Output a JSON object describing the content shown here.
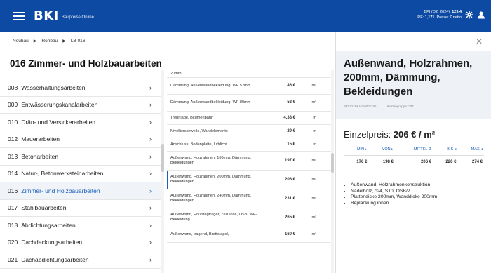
{
  "app": {
    "logo": "BKI",
    "subtitle": "Baupreise Online",
    "index_line1_label": "BPI (Q2, 2024):",
    "index_line1_value": "129,4",
    "index_line2_label": "RF:",
    "index_line2_value": "1,171",
    "index_line2_suffix": "Preise: € netto"
  },
  "breadcrumb": [
    "Neubau",
    "Rohbau",
    "LB 016"
  ],
  "page_title": "016  Zimmer- und Holzbauarbeiten",
  "categories": [
    {
      "num": "008",
      "name": "Wasserhaltungsarbeiten"
    },
    {
      "num": "009",
      "name": "Entwässerungskanalarbeiten"
    },
    {
      "num": "010",
      "name": "Drän- und Versickerarbeiten"
    },
    {
      "num": "012",
      "name": "Mauerarbeiten"
    },
    {
      "num": "013",
      "name": "Betonarbeiten"
    },
    {
      "num": "014",
      "name": "Natur-, Betonwerksteinarbeiten"
    },
    {
      "num": "016",
      "name": "Zimmer- und Holzbauarbeiten"
    },
    {
      "num": "017",
      "name": "Stahlbauarbeiten"
    },
    {
      "num": "018",
      "name": "Abdichtungsarbeiten"
    },
    {
      "num": "020",
      "name": "Dachdeckungsarbeiten"
    },
    {
      "num": "021",
      "name": "Dachabdichtungsarbeiten"
    }
  ],
  "positions": [
    {
      "name": "20mm",
      "price": "",
      "unit": ""
    },
    {
      "name": "Dämmung, Außenwandbekleidung, WF 52mm",
      "price": "46 €",
      "unit": "m²"
    },
    {
      "name": "Dämmung, Außenwandbekleidung, WF 80mm",
      "price": "53 €",
      "unit": "m²"
    },
    {
      "name": "Trennlage, Bitumenbahn",
      "price": "4,38 €",
      "unit": "m"
    },
    {
      "name": "Nivellierschwelle, Wandelemente",
      "price": "29 €",
      "unit": "m"
    },
    {
      "name": "Anschluss, Bodenplatte, luftdicht",
      "price": "15 €",
      "unit": "m"
    },
    {
      "name": "Außenwand, Holzrahmen, 160mm, Dämmung, Bekleidungen",
      "price": "197 €",
      "unit": "m²"
    },
    {
      "name": "Außenwand, Holzrahmen, 200mm, Dämmung, Bekleidungen",
      "price": "206 €",
      "unit": "m²"
    },
    {
      "name": "Außenwand, Holzrahmen, 240mm, Dämmung, Bekleidungen",
      "price": "231 €",
      "unit": "m²"
    },
    {
      "name": "Außenwand, Holzstegträger, Zellulose, OSB, WF-Bekleidung",
      "price": "265 €",
      "unit": "m²"
    },
    {
      "name": "Außenwand, tragend, Brettstapel,",
      "price": "160 €",
      "unit": "m²"
    }
  ],
  "detail": {
    "title": "Außenwand, Holzrahmen, 200mm, Dämmung, Bekleidungen",
    "bki_id": "BKI ID: BKI-016001156",
    "kostengruppe": "Kostengruppe: 337",
    "price_label": "Einzelpreis:",
    "price_value": "206 € / m²",
    "price_headers": [
      "MIN ▸",
      "VON ▸",
      "MITTEL Ø",
      "BIS ◂",
      "MAX ◂"
    ],
    "price_values": [
      "176 €",
      "198 €",
      "206 €",
      "226 €",
      "274 €"
    ],
    "bullets": [
      "Außenwand, Holzrahmenkonstruktion",
      "Nadelholz, c24, S10, OSB/2",
      "Plattendicke 200mm, Wanddicke 200mm",
      "Beplankung innen"
    ]
  },
  "colors": {
    "brand": "#0c4aa3",
    "accent": "#1b5fb8"
  },
  "icons": {
    "menu": "hamburger-icon",
    "settings": "gear-icon",
    "account": "user-icon",
    "close": "close-icon",
    "chevron": "chevron-right-icon"
  }
}
